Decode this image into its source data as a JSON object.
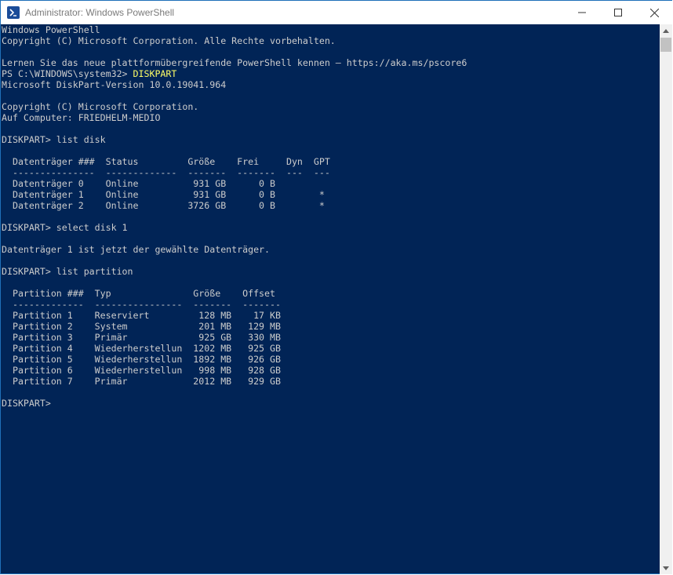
{
  "window": {
    "title": "Administrator: Windows PowerShell",
    "icon": "powershell-icon",
    "controls": {
      "minimize_icon": "minimize-icon",
      "maximize_icon": "maximize-icon",
      "close_icon": "close-icon"
    }
  },
  "colors": {
    "console_bg": "#012456",
    "console_text": "#cccccc",
    "command_highlight": "#ffff66"
  },
  "console": {
    "header": "Windows PowerShell\nCopyright (C) Microsoft Corporation. Alle Rechte vorbehalten.\n\nLernen Sie das neue plattformübergreifende PowerShell kennen – https://aka.ms/pscore6\n",
    "prompt1": "PS C:\\WINDOWS\\system32> ",
    "command1": "DISKPART",
    "output": "\nMicrosoft DiskPart-Version 10.0.19041.964\n\nCopyright (C) Microsoft Corporation.\nAuf Computer: FRIEDHELM-MEDIO\n\nDISKPART> list disk\n\n  Datenträger ###  Status         Größe    Frei     Dyn  GPT\n  ---------------  -------------  -------  -------  ---  ---\n  Datenträger 0    Online          931 GB      0 B\n  Datenträger 1    Online          931 GB      0 B        *\n  Datenträger 2    Online         3726 GB      0 B        *\n\nDISKPART> select disk 1\n\nDatenträger 1 ist jetzt der gewählte Datenträger.\n\nDISKPART> list partition\n\n  Partition ###  Typ               Größe    Offset\n  -------------  ----------------  -------  -------\n  Partition 1    Reserviert         128 MB    17 KB\n  Partition 2    System             201 MB   129 MB\n  Partition 3    Primär             925 GB   330 MB\n  Partition 4    Wiederherstellun  1202 MB   925 GB\n  Partition 5    Wiederherstellun  1892 MB   926 GB\n  Partition 6    Wiederherstellun   998 MB   928 GB\n  Partition 7    Primär            2012 MB   929 GB\n\nDISKPART> "
  },
  "scrollbar": {
    "up_icon": "scroll-up-arrow-icon",
    "down_icon": "scroll-down-arrow-icon"
  }
}
